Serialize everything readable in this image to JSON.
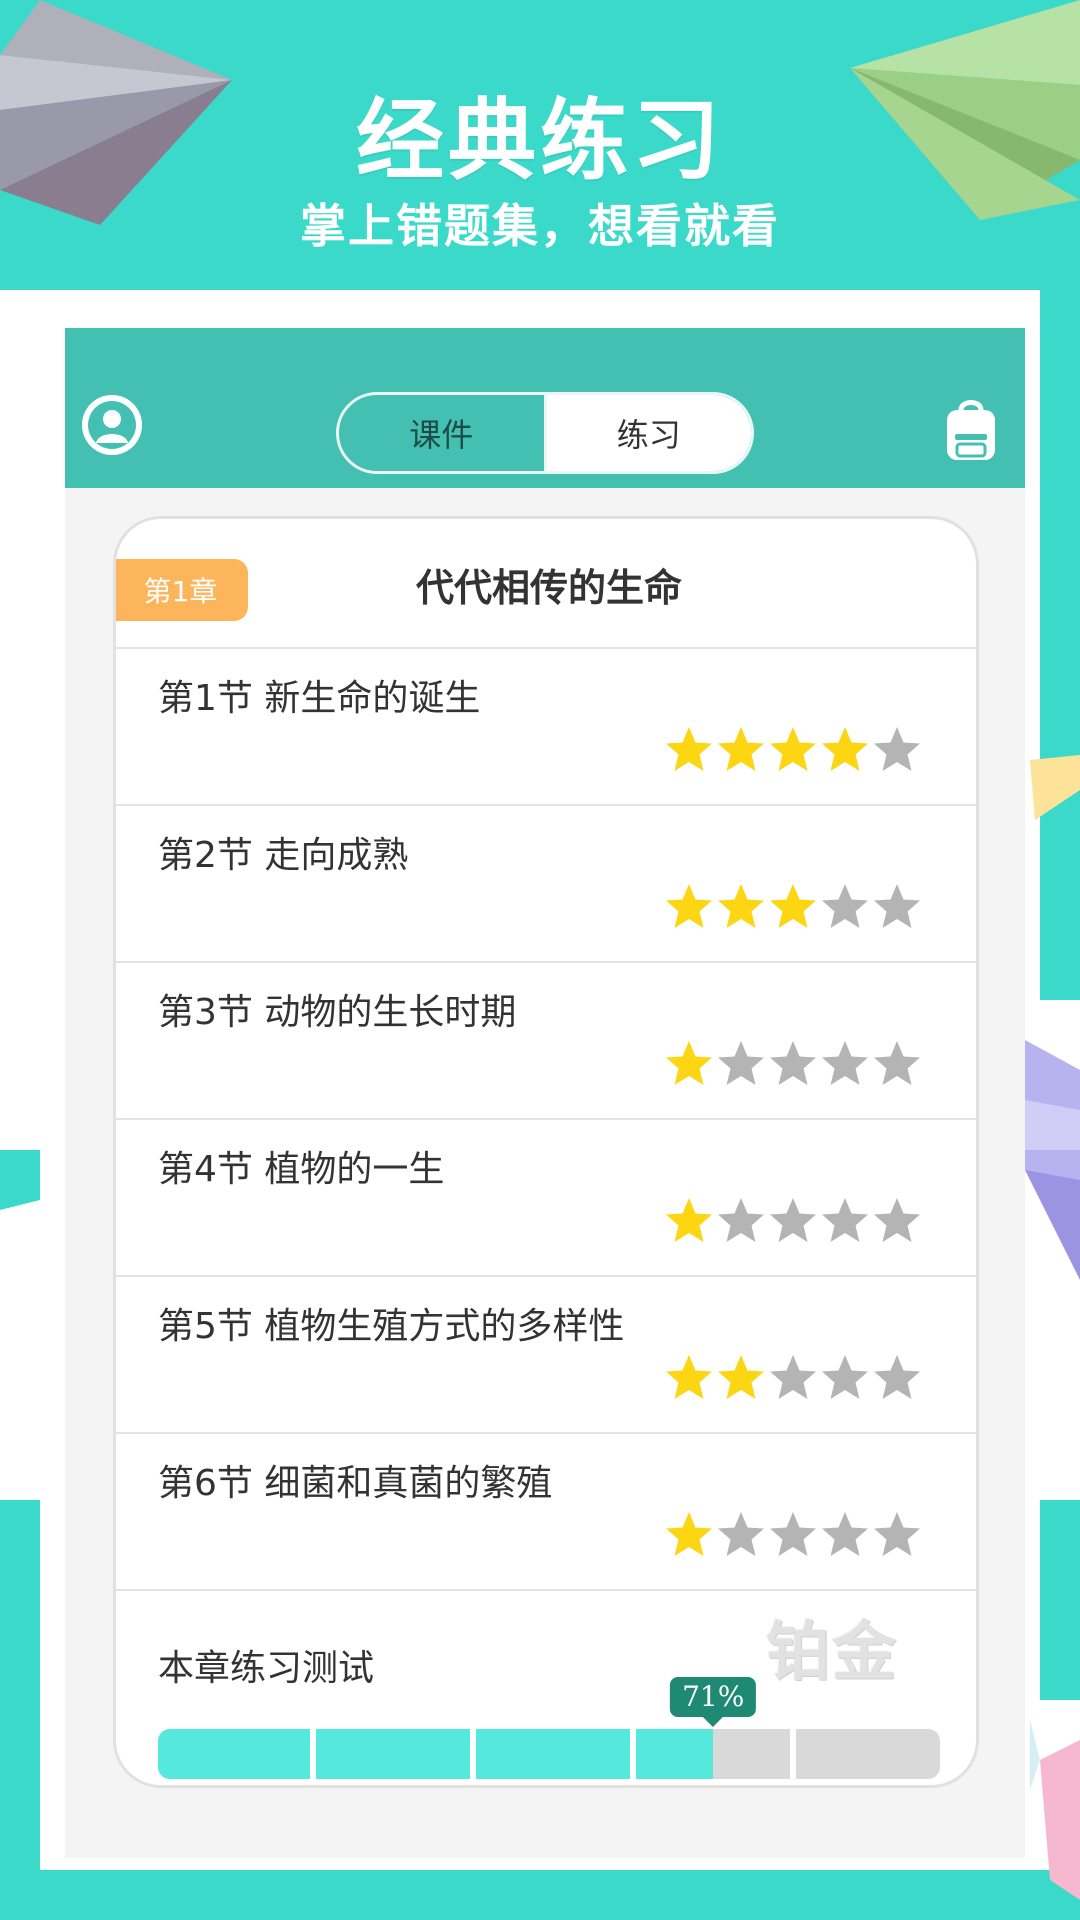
{
  "promo": {
    "title": "经典练习",
    "subtitle": "掌上错题集，想看就看"
  },
  "colors": {
    "teal_bg": "#3ad9c9",
    "header": "#44c0b3",
    "badge": "#fdb55c",
    "star_on": "#fcd513",
    "star_off": "#b4b4b4",
    "progress_fill": "#55e8dc",
    "tooltip": "#1e8a74"
  },
  "header": {
    "avatar_icon": "user-avatar-icon",
    "tabs": [
      {
        "label": "课件",
        "active": false
      },
      {
        "label": "练习",
        "active": true
      }
    ],
    "bag_icon": "backpack-icon"
  },
  "chapter": {
    "badge": "第1章",
    "title": "代代相传的生命"
  },
  "sections": [
    {
      "name": "第1节 新生命的诞生",
      "stars": 4
    },
    {
      "name": "第2节 走向成熟",
      "stars": 3
    },
    {
      "name": "第3节 动物的生长时期",
      "stars": 1
    },
    {
      "name": "第4节 植物的一生",
      "stars": 1
    },
    {
      "name": "第5节 植物生殖方式的多样性",
      "stars": 2
    },
    {
      "name": "第6节 细菌和真菌的繁殖",
      "stars": 1
    }
  ],
  "max_stars": 5,
  "test": {
    "label": "本章练习测试",
    "medal": "铂金",
    "progress": 0.71,
    "progress_label": "71%"
  }
}
